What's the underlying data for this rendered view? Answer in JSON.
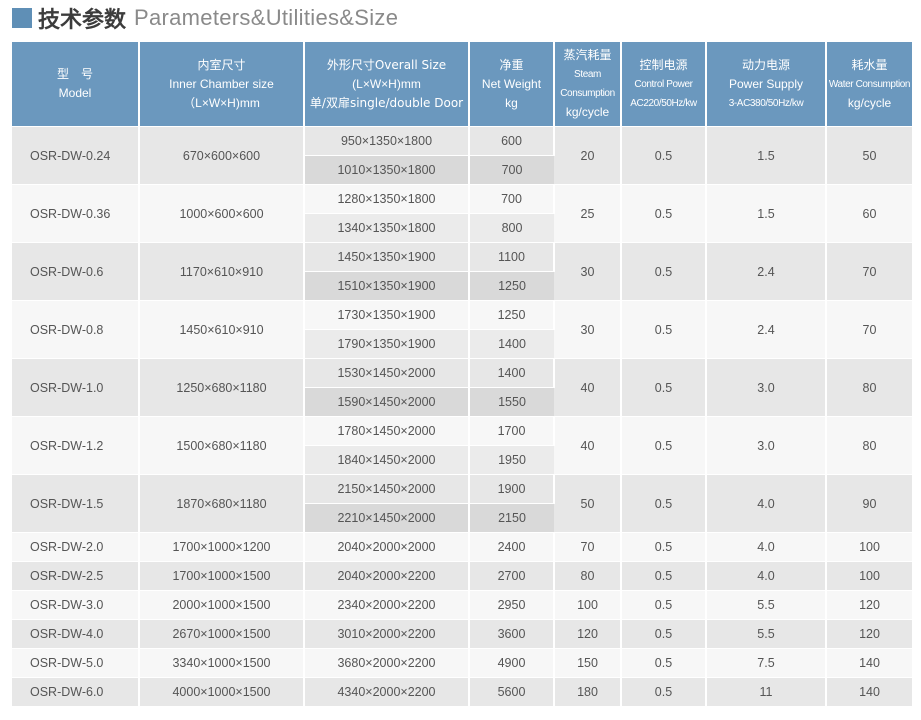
{
  "title": {
    "cn": "技术参数",
    "en": "Parameters&Utilities&Size"
  },
  "header": {
    "model": [
      "型　号",
      "Model"
    ],
    "inner": [
      "内室尺寸",
      "Inner Chamber size",
      "（L×W×H)mm"
    ],
    "overall": [
      "外形尺寸Overall Size",
      "(L×W×H)mm",
      "单/双扉single/double Door"
    ],
    "weight": [
      "净重",
      "Net Weight",
      "kg"
    ],
    "steam": [
      "蒸汽耗量",
      "Steam Consumption",
      "kg/cycle"
    ],
    "control": [
      "控制电源",
      "Control Power",
      "AC220/50Hz/kw"
    ],
    "power": [
      "动力电源",
      "Power Supply",
      "3-AC380/50Hz/kw"
    ],
    "water": [
      "耗水量",
      "Water Consumption",
      "kg/cycle"
    ]
  },
  "rows": [
    {
      "model": "OSR-DW-0.24",
      "inner": "670×600×600",
      "overall": [
        "950×1350×1800",
        "1010×1350×1800"
      ],
      "weight": [
        "600",
        "700"
      ],
      "steam": "20",
      "control": "0.5",
      "power": "1.5",
      "water": "50"
    },
    {
      "model": "OSR-DW-0.36",
      "inner": "1000×600×600",
      "overall": [
        "1280×1350×1800",
        "1340×1350×1800"
      ],
      "weight": [
        "700",
        "800"
      ],
      "steam": "25",
      "control": "0.5",
      "power": "1.5",
      "water": "60"
    },
    {
      "model": "OSR-DW-0.6",
      "inner": "1170×610×910",
      "overall": [
        "1450×1350×1900",
        "1510×1350×1900"
      ],
      "weight": [
        "1100",
        "1250"
      ],
      "steam": "30",
      "control": "0.5",
      "power": "2.4",
      "water": "70"
    },
    {
      "model": "OSR-DW-0.8",
      "inner": "1450×610×910",
      "overall": [
        "1730×1350×1900",
        "1790×1350×1900"
      ],
      "weight": [
        "1250",
        "1400"
      ],
      "steam": "30",
      "control": "0.5",
      "power": "2.4",
      "water": "70"
    },
    {
      "model": "OSR-DW-1.0",
      "inner": "1250×680×1180",
      "overall": [
        "1530×1450×2000",
        "1590×1450×2000"
      ],
      "weight": [
        "1400",
        "1550"
      ],
      "steam": "40",
      "control": "0.5",
      "power": "3.0",
      "water": "80"
    },
    {
      "model": "OSR-DW-1.2",
      "inner": "1500×680×1180",
      "overall": [
        "1780×1450×2000",
        "1840×1450×2000"
      ],
      "weight": [
        "1700",
        "1950"
      ],
      "steam": "40",
      "control": "0.5",
      "power": "3.0",
      "water": "80"
    },
    {
      "model": "OSR-DW-1.5",
      "inner": "1870×680×1180",
      "overall": [
        "2150×1450×2000",
        "2210×1450×2000"
      ],
      "weight": [
        "1900",
        "2150"
      ],
      "steam": "50",
      "control": "0.5",
      "power": "4.0",
      "water": "90"
    },
    {
      "model": "OSR-DW-2.0",
      "inner": "1700×1000×1200",
      "overall": [
        "2040×2000×2000"
      ],
      "weight": [
        "2400"
      ],
      "steam": "70",
      "control": "0.5",
      "power": "4.0",
      "water": "100"
    },
    {
      "model": "OSR-DW-2.5",
      "inner": "1700×1000×1500",
      "overall": [
        "2040×2000×2200"
      ],
      "weight": [
        "2700"
      ],
      "steam": "80",
      "control": "0.5",
      "power": "4.0",
      "water": "100"
    },
    {
      "model": "OSR-DW-3.0",
      "inner": "2000×1000×1500",
      "overall": [
        "2340×2000×2200"
      ],
      "weight": [
        "2950"
      ],
      "steam": "100",
      "control": "0.5",
      "power": "5.5",
      "water": "120"
    },
    {
      "model": "OSR-DW-4.0",
      "inner": "2670×1000×1500",
      "overall": [
        "3010×2000×2200"
      ],
      "weight": [
        "3600"
      ],
      "steam": "120",
      "control": "0.5",
      "power": "5.5",
      "water": "120"
    },
    {
      "model": "OSR-DW-5.0",
      "inner": "3340×1000×1500",
      "overall": [
        "3680×2000×2200"
      ],
      "weight": [
        "4900"
      ],
      "steam": "150",
      "control": "0.5",
      "power": "7.5",
      "water": "140"
    },
    {
      "model": "OSR-DW-6.0",
      "inner": "4000×1000×1500",
      "overall": [
        "4340×2000×2200"
      ],
      "weight": [
        "5600"
      ],
      "steam": "180",
      "control": "0.5",
      "power": "11",
      "water": "140"
    }
  ],
  "colors": {
    "header_bg": "#6b98be",
    "title_square": "#5f8fb6",
    "row_dark": "#e7e7e7",
    "row_light": "#f7f7f7"
  }
}
